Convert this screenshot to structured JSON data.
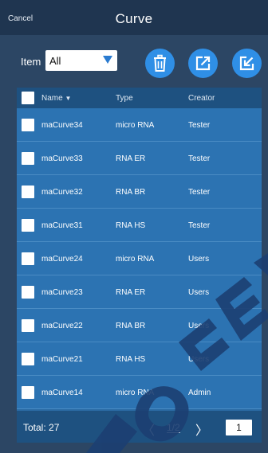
{
  "header": {
    "cancel_label": "Cancel",
    "title": "Curve"
  },
  "toolbar": {
    "item_label": "Item",
    "item_select_value": "All",
    "actions": [
      {
        "name": "delete-button",
        "icon": "trash-icon"
      },
      {
        "name": "export-button",
        "icon": "export-icon"
      },
      {
        "name": "edit-button",
        "icon": "edit-icon"
      }
    ]
  },
  "table": {
    "columns": [
      "Name",
      "Type",
      "Creator"
    ],
    "sort_indicator": "▼",
    "rows": [
      {
        "name": "maCurve34",
        "type": "micro RNA",
        "creator": "Tester"
      },
      {
        "name": "maCurve33",
        "type": "RNA ER",
        "creator": "Tester"
      },
      {
        "name": "maCurve32",
        "type": "RNA BR",
        "creator": "Tester"
      },
      {
        "name": "maCurve31",
        "type": "RNA HS",
        "creator": "Tester"
      },
      {
        "name": "maCurve24",
        "type": "micro RNA",
        "creator": "Users"
      },
      {
        "name": "maCurve23",
        "type": "RNA ER",
        "creator": "Users"
      },
      {
        "name": "maCurve22",
        "type": "RNA BR",
        "creator": "Users"
      },
      {
        "name": "maCurve21",
        "type": "RNA HS",
        "creator": "Users"
      },
      {
        "name": "maCurve14",
        "type": "micro RNA",
        "creator": "Admin"
      }
    ]
  },
  "footer": {
    "total_label": "Total: 27",
    "prev": "〈",
    "page_label": "1/2",
    "next": "〉",
    "page_input": "1"
  },
  "colors": {
    "background": "#2c4664",
    "header": "#1f3550",
    "accent": "#2f8fe6",
    "row": "#2c73b2",
    "table_header": "#1e5180"
  }
}
